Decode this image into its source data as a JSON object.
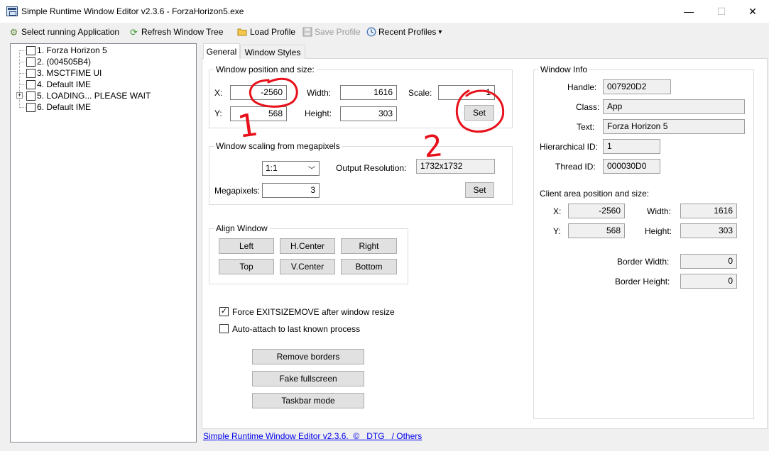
{
  "window": {
    "title": "Simple Runtime Window Editor v2.3.6 - ForzaHorizon5.exe",
    "min_glyph": "—",
    "max_glyph": "☐",
    "close_glyph": "✕"
  },
  "toolbar": {
    "select_app": "Select running Application",
    "refresh_tree": "Refresh Window Tree",
    "load_profile": "Load Profile",
    "save_profile": "Save Profile",
    "recent_profiles": "Recent Profiles",
    "dropdown_arrow": "▾",
    "icons": {
      "select_app": "gear-icon",
      "refresh_tree": "refresh-icon",
      "load_profile": "folder-icon",
      "save_profile": "floppy-disk-icon",
      "recent_profiles": "clock-icon"
    }
  },
  "tree": {
    "items": [
      {
        "label": "1. Forza Horizon 5"
      },
      {
        "label": "2. (004505B4)"
      },
      {
        "label": "3. MSCTFIME UI"
      },
      {
        "label": "4. Default IME"
      },
      {
        "label": "5. LOADING... PLEASE WAIT",
        "expandable": true
      },
      {
        "label": "6. Default IME"
      }
    ],
    "expander_glyph": "+"
  },
  "tabs": {
    "general": "General",
    "window_styles": "Window Styles"
  },
  "position": {
    "group_title": "Window position and size:",
    "x_label": "X:",
    "x_value": "-2560",
    "y_label": "Y:",
    "y_value": "568",
    "width_label": "Width:",
    "width_value": "1616",
    "height_label": "Height:",
    "height_value": "303",
    "scale_label": "Scale:",
    "scale_value": "1",
    "set_button": "Set"
  },
  "scaling": {
    "group_title": "Window scaling from megapixels",
    "ratio_value": "1:1",
    "output_resolution_label": "Output Resolution:",
    "output_resolution_value": "1732x1732",
    "megapixels_label": "Megapixels:",
    "megapixels_value": "3",
    "set_button": "Set"
  },
  "align": {
    "group_title": "Align Window",
    "left": "Left",
    "hcenter": "H.Center",
    "right": "Right",
    "top": "Top",
    "vcenter": "V.Center",
    "bottom": "Bottom"
  },
  "options": {
    "force_exitsizemove": "Force EXITSIZEMOVE after window resize",
    "force_exitsizemove_checked": true,
    "auto_attach": "Auto-attach to last known process",
    "auto_attach_checked": false,
    "check_glyph": "✓"
  },
  "actions": {
    "remove_borders": "Remove borders",
    "fake_fullscreen": "Fake fullscreen",
    "taskbar_mode": "Taskbar mode"
  },
  "window_info": {
    "group_title": "Window Info",
    "handle_label": "Handle:",
    "handle_value": "007920D2",
    "class_label": "Class:",
    "class_value": "App",
    "text_label": "Text:",
    "text_value": "Forza Horizon 5",
    "hier_id_label": "Hierarchical ID:",
    "hier_id_value": "1",
    "thread_id_label": "Thread ID:",
    "thread_id_value": "000030D0",
    "client_area_title": "Client area position and size:",
    "cx_label": "X:",
    "cx_value": "-2560",
    "cy_label": "Y:",
    "cy_value": "568",
    "cwidth_label": "Width:",
    "cwidth_value": "1616",
    "cheight_label": "Height:",
    "cheight_value": "303",
    "border_width_label": "Border Width:",
    "border_width_value": "0",
    "border_height_label": "Border Height:",
    "border_height_value": "0"
  },
  "footer": {
    "link": "Simple Runtime Window Editor v2.3.6.  ©   DTG   / Others"
  },
  "annotations": {
    "color": "#e8101a",
    "mark_1": "1",
    "mark_2": "2"
  }
}
